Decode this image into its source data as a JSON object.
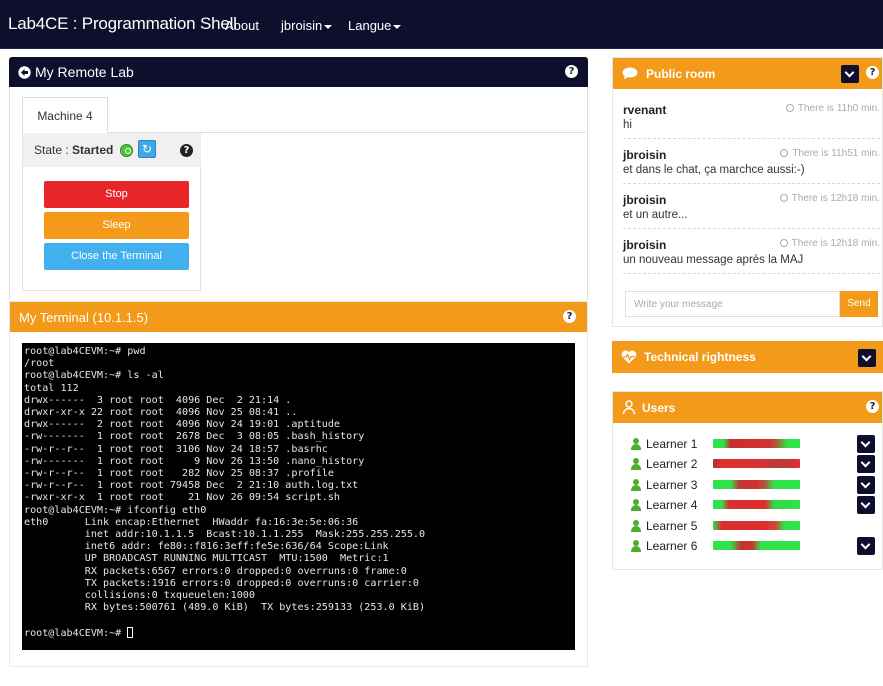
{
  "navbar": {
    "brand": "Lab4CE : Programmation Shell",
    "items": [
      "About",
      "jbroisin",
      "Langue"
    ]
  },
  "remote_lab": {
    "title": "My Remote Lab",
    "tab": "Machine 4",
    "state_label": "State :",
    "state_value": "Started",
    "buttons": {
      "stop": {
        "label": "Stop",
        "color": "#e8262a"
      },
      "sleep": {
        "label": "Sleep",
        "color": "#f39a1a"
      },
      "close_terminal": {
        "label": "Close the Terminal",
        "color": "#42b0ef"
      }
    }
  },
  "terminal": {
    "title": "My Terminal  (10.1.1.5)",
    "lines": [
      "root@lab4CEVM:~# pwd",
      "/root",
      "root@lab4CEVM:~# ls -al",
      "total 112",
      "drwx------  3 root root  4096 Dec  2 21:14 .",
      "drwxr-xr-x 22 root root  4096 Nov 25 08:41 ..",
      "drwx------  2 root root  4096 Nov 24 19:01 .aptitude",
      "-rw-------  1 root root  2678 Dec  3 08:05 .bash_history",
      "-rw-r--r--  1 root root  3106 Nov 24 18:57 .basrhc",
      "-rw-------  1 root root     9 Nov 26 13:50 .nano_history",
      "-rw-r--r--  1 root root   282 Nov 25 08:37 .profile",
      "-rw-r--r--  1 root root 79458 Dec  2 21:10 auth.log.txt",
      "-rwxr-xr-x  1 root root    21 Nov 26 09:54 script.sh",
      "root@lab4CEVM:~# ifconfig eth0",
      "eth0      Link encap:Ethernet  HWaddr fa:16:3e:5e:06:36",
      "          inet addr:10.1.1.5  Bcast:10.1.1.255  Mask:255.255.255.0",
      "          inet6 addr: fe80::f816:3eff:fe5e:636/64 Scope:Link",
      "          UP BROADCAST RUNNING MULTICAST  MTU:1500  Metric:1",
      "          RX packets:6567 errors:0 dropped:0 overruns:0 frame:0",
      "          TX packets:1916 errors:0 dropped:0 overruns:0 carrier:0",
      "          collisions:0 txqueuelen:1000",
      "          RX bytes:500761 (489.0 KiB)  TX bytes:259133 (253.0 KiB)",
      "",
      "root@lab4CEVM:~# "
    ]
  },
  "public_room": {
    "title": "Public room",
    "messages": [
      {
        "author": "rvenant",
        "time": "There is 11h0 min.",
        "text": "hi"
      },
      {
        "author": "jbroisin",
        "time": "There is 11h51 min.",
        "text": "et dans le chat, ça marchce aussi:-)"
      },
      {
        "author": "jbroisin",
        "time": "There is 12h18 min.",
        "text": "et un autre..."
      },
      {
        "author": "jbroisin",
        "time": "There is 12h18 min.",
        "text": "un nouveau message après la MAJ"
      }
    ],
    "input_placeholder": "Write your message",
    "send_label": "Send"
  },
  "technical_rightness": {
    "title": "Technical rightness"
  },
  "users": {
    "title": "Users",
    "learners": [
      {
        "name": "Learner 1",
        "meter": "linear-gradient(90deg,#2ee34a 0%,#2ee34a 12%,#c72f2f 20%,#d63030 65%,#9a6e3a 75%,#2ee34a 85%,#2ee34a 100%)",
        "expand": true
      },
      {
        "name": "Learner 2",
        "meter": "linear-gradient(90deg,#a33 0%,#e03030 10%,#d93232 50%,#b63b3b 80%,#e52d2d 100%)",
        "expand": true
      },
      {
        "name": "Learner 3",
        "meter": "linear-gradient(90deg,#2ee34a 0%,#2ee34a 20%,#b93a3a 30%,#d52f2f 50%,#b05a3a 60%,#2ee34a 70%,#2ee34a 100%)",
        "expand": true
      },
      {
        "name": "Learner 4",
        "meter": "linear-gradient(90deg,#2ee34a 0%,#2ee34a 10%,#d53030 18%,#e02c2c 60%,#33d64a 70%,#2ee34a 100%)",
        "expand": true
      },
      {
        "name": "Learner 5",
        "meter": "linear-gradient(90deg,#2ee34a 0%,#d83030 10%,#e02c2c 60%,#c94a3a 72%,#2ee34a 82%,#2ee34a 100%)",
        "expand": false
      },
      {
        "name": "Learner 6",
        "meter": "linear-gradient(90deg,#2ee34a 0%,#2ee34a 20%,#c13636 32%,#d22f2f 45%,#2ee34a 55%,#2ee34a 100%)",
        "expand": true
      }
    ]
  },
  "colors": {
    "navy": "#0d0f2c",
    "orange": "#f39a1a",
    "green": "#2ee34a",
    "red": "#e02c2c"
  },
  "icons": [
    "arrow-circle-left-icon",
    "question-icon",
    "power-icon",
    "refresh-icon",
    "chat-bubble-icon",
    "chevron-down-icon",
    "clock-icon",
    "heartbeat-icon",
    "users-icon",
    "user-icon"
  ]
}
